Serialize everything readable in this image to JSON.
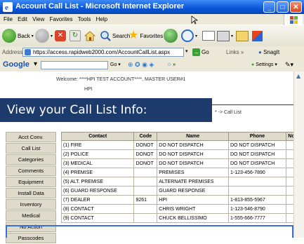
{
  "window": {
    "title": "Account Call List - Microsoft Internet Explorer"
  },
  "menu": [
    "File",
    "Edit",
    "View",
    "Favorites",
    "Tools",
    "Help"
  ],
  "toolbar": {
    "back": "Back",
    "search": "Search",
    "favorites": "Favorites"
  },
  "addressbar": {
    "label": "Address",
    "url": "https://access.rapidweb2000.com/AccountCallList.aspx",
    "go": "Go",
    "links": "Links",
    "snagit": "SnagIt"
  },
  "googlebar": {
    "label": "Google",
    "go": "Go",
    "settings": "Settings"
  },
  "page": {
    "welcome": "Welcome:  ****HPI TEST ACCOUNT****, MASTER USER#1",
    "company": "HPI",
    "banner": "View your Call List Info:",
    "breadcrumb": "* -> Call List"
  },
  "sidebar": {
    "items": [
      "Acct Conv.",
      "Call List",
      "Categories",
      "Comments",
      "Equipment",
      "Install Data",
      "Inventory",
      "Medical",
      "No Action",
      "Passcodes"
    ]
  },
  "table": {
    "headers": [
      "Contact",
      "Code",
      "Name",
      "Phone",
      "Notes"
    ],
    "rows": [
      [
        "(1) FIRE",
        "DONOT",
        "DO NOT DISPATCH",
        "DO NOT DISPATCH",
        ""
      ],
      [
        "(2) POLICE",
        "DONOT",
        "DO NOT DISPATCH",
        "DO NOT DISPATCH",
        ""
      ],
      [
        "(3) MEDICAL",
        "DONOT",
        "DO NOT DISPATCH",
        "DO NOT DISPATCH",
        ""
      ],
      [
        "(4) PREMISE",
        "",
        "PREMISES",
        "1-123-456-7890",
        ""
      ],
      [
        "(5) ALT. PREMISE",
        "",
        "ALTERNATE PREMISES",
        "",
        ""
      ],
      [
        "(6) GUARD RESPONSE",
        "",
        "GUARD RESPONSE",
        "",
        ""
      ],
      [
        "(7) DEALER",
        "9261",
        "HPI",
        "1-813-855-5967",
        ""
      ],
      [
        "(8) CONTACT",
        "",
        "CHRIS WRIGHT",
        "1-123-546-8790",
        ""
      ],
      [
        "(9) CONTACT",
        "",
        "CHUCK BELLISSIMO",
        "1-555-666-7777",
        ""
      ]
    ]
  },
  "colors": {
    "titlebar": "#0a56d6",
    "banner": "#1d3a6c",
    "redline": "#cc0000"
  }
}
